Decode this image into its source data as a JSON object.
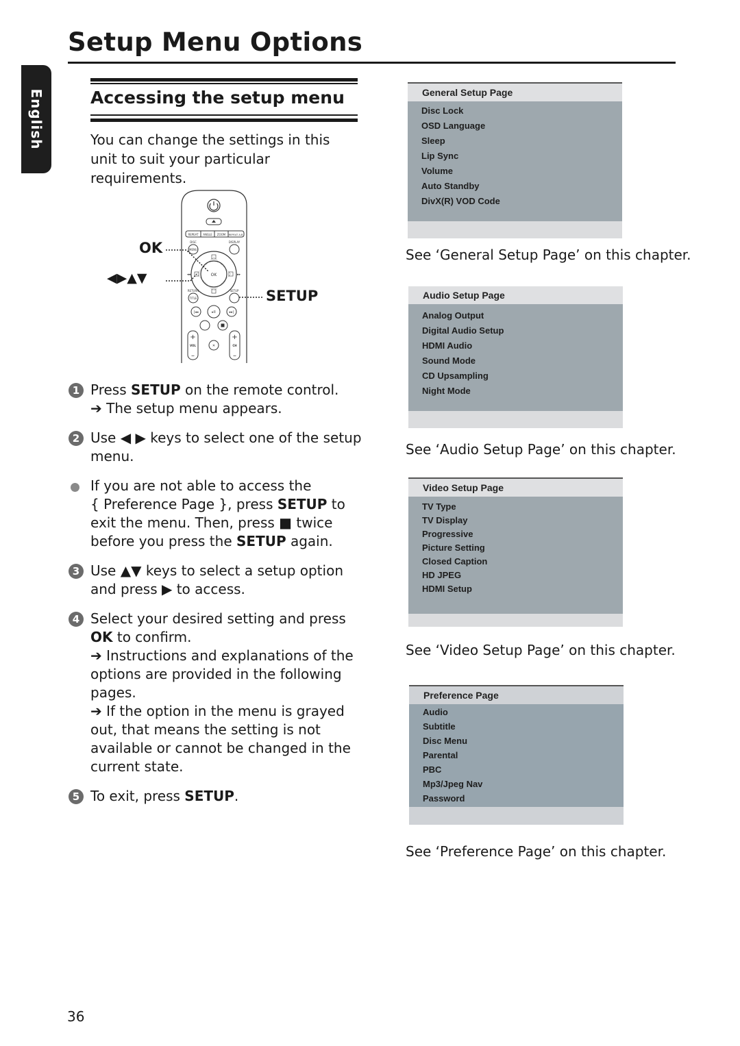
{
  "page_title": "Setup Menu Options",
  "language_tab": "English",
  "section": {
    "heading": "Accessing the setup menu",
    "intro": "You can change the settings in this unit to suit your particular requirements."
  },
  "remote": {
    "callouts": {
      "ok": "OK",
      "arrows": "◀▶▲▼",
      "setup": "SETUP"
    },
    "button_labels": {
      "repeat": "REPEAT",
      "angle": "ANGLE",
      "zoom": "ZOOM",
      "repeat_ab": "REPEAT A-B",
      "disc": "DISC",
      "menu": "MENU",
      "display": "DISPLAY",
      "ok": "OK",
      "return": "RETURN",
      "title": "TITLE",
      "setup": "SETUP",
      "vol": "VOL",
      "ch": "CH"
    }
  },
  "steps": [
    {
      "num": "1",
      "pre": "Press ",
      "bold": "SETUP",
      "post": " on the remote control.",
      "result": "➔ The setup menu appears."
    },
    {
      "num": "2",
      "text": "Use ◀ ▶ keys to select one of the setup menu."
    },
    {
      "bullet": true,
      "l1": "If you are not able to access the",
      "l2_pre": "{ Preference Page }, press ",
      "l2_bold": "SETUP",
      "l2_post": " to",
      "l3": "exit the menu. Then, press ■ twice",
      "l4_pre": "before you press the ",
      "l4_bold": "SETUP",
      "l4_post": " again."
    },
    {
      "num": "3",
      "text": "Use ▲▼ keys to select a setup option and press ▶ to access."
    },
    {
      "num": "4",
      "pre": "Select your desired setting and press ",
      "bold": "OK",
      "post": " to confirm.",
      "result1": "➔ Instructions and explanations of the options are provided in the following pages.",
      "result2": "➔ If the option in the menu is grayed out, that means the setting is not available or cannot be changed in the current state."
    },
    {
      "num": "5",
      "pre": "To exit, press ",
      "bold": "SETUP",
      "post": "."
    }
  ],
  "menus": [
    {
      "title": "General Setup Page",
      "items": [
        "Disc Lock",
        "OSD Language",
        "Sleep",
        "Lip Sync",
        "Volume",
        "Auto Standby",
        "DivX(R) VOD Code"
      ],
      "caption": "See ‘General Setup Page’ on this chapter."
    },
    {
      "title": "Audio Setup Page",
      "items": [
        "Analog Output",
        "Digital Audio Setup",
        "HDMI Audio",
        "Sound Mode",
        "CD Upsampling",
        "Night Mode"
      ],
      "caption": "See ‘Audio Setup Page’ on this chapter."
    },
    {
      "title": "Video Setup Page",
      "items": [
        "TV Type",
        "TV Display",
        "Progressive",
        "Picture Setting",
        "Closed Caption",
        "HD JPEG",
        "HDMI Setup"
      ],
      "caption": "See ‘Video Setup Page’ on this chapter."
    },
    {
      "title": "Preference Page",
      "items": [
        "Audio",
        "Subtitle",
        "Disc Menu",
        "Parental",
        "PBC",
        "Mp3/Jpeg Nav",
        "Password"
      ],
      "caption": "See ‘Preference Page’ on this chapter."
    }
  ],
  "page_number": "36"
}
